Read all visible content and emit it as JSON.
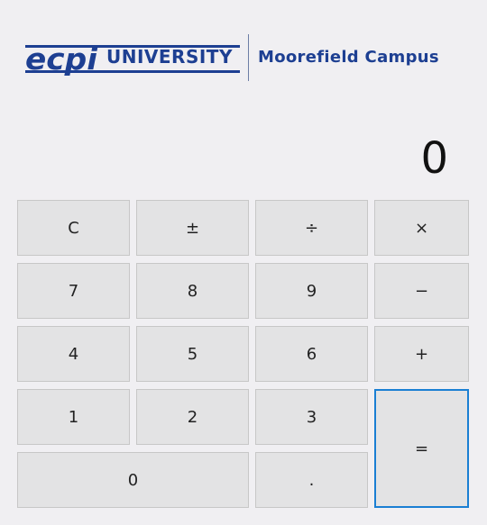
{
  "header": {
    "logo_text": "ecpi",
    "logo_word": "UNIVERSITY",
    "campus": "Moorefield Campus"
  },
  "display": {
    "value": "0"
  },
  "keys": {
    "clear": "C",
    "plus_minus": "±",
    "divide": "÷",
    "multiply": "×",
    "seven": "7",
    "eight": "8",
    "nine": "9",
    "minus": "−",
    "four": "4",
    "five": "5",
    "six": "6",
    "plus": "+",
    "one": "1",
    "two": "2",
    "three": "3",
    "equals": "=",
    "zero": "0",
    "decimal": "."
  },
  "colors": {
    "brand_blue": "#1d3f92",
    "background": "#f0eff2",
    "key_face": "#e3e3e4",
    "focus_border": "#1a7fd3"
  }
}
